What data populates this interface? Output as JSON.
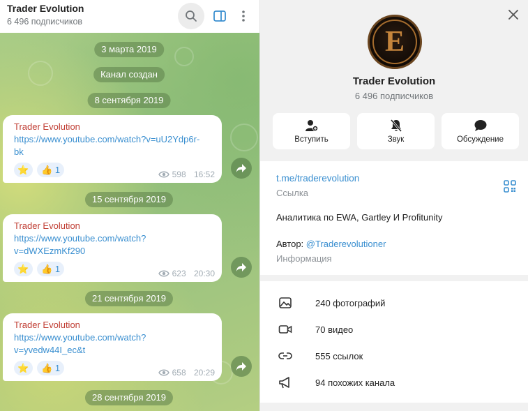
{
  "header": {
    "title": "Trader Evolution",
    "subtitle": "6 496 подписчиков",
    "icons": [
      "search-icon",
      "side-panel-icon",
      "more-vertical-icon"
    ]
  },
  "chat": {
    "date_pills": [
      "3 марта 2019",
      "Канал создан",
      "8 сентября 2019",
      "15 сентября 2019",
      "21 сентября 2019",
      "28 сентября 2019"
    ],
    "messages": [
      {
        "author": "Trader Evolution",
        "link": "https://www.youtube.com/watch?v=uU2Ydp6r-bk",
        "link_line1": "https://www.youtube.com/watch?v=uU2Ydp6r-",
        "link_line2": "bk",
        "reaction_star": "⭐",
        "reaction_like": "👍",
        "like_count": "1",
        "views": "598",
        "time": "16:52"
      },
      {
        "author": "Trader Evolution",
        "link": "https://www.youtube.com/watch?v=dWXEzmKf290",
        "link_line1": "https://www.youtube.com/watch?",
        "link_line2": "v=dWXEzmKf290",
        "reaction_star": "⭐",
        "reaction_like": "👍",
        "like_count": "1",
        "views": "623",
        "time": "20:30"
      },
      {
        "author": "Trader Evolution",
        "link": "https://www.youtube.com/watch?v=yvedw44I_ec&t",
        "link_line1": "https://www.youtube.com/watch?",
        "link_line2": "v=yvedw44I_ec&t",
        "reaction_star": "⭐",
        "reaction_like": "👍",
        "like_count": "1",
        "views": "658",
        "time": "20:29"
      }
    ]
  },
  "panel": {
    "avatar_letter": "E",
    "name": "Trader Evolution",
    "subscribers": "6 496 подписчиков",
    "actions": [
      {
        "label": "Вступить",
        "icon": "add-user-icon"
      },
      {
        "label": "Звук",
        "icon": "bell-muted-icon"
      },
      {
        "label": "Обсуждение",
        "icon": "chat-bubble-icon"
      }
    ],
    "info": {
      "link": "t.me/traderevolution",
      "link_caption": "Ссылка",
      "description": "Аналитика по EWA, Gartley И Profitunity",
      "author_prefix": "Автор:",
      "author_handle": "@Traderevolutioner",
      "author_caption": "Информация"
    },
    "media": [
      {
        "label": "240 фотографий",
        "icon": "photo-icon"
      },
      {
        "label": "70 видео",
        "icon": "video-icon"
      },
      {
        "label": "555 ссылок",
        "icon": "link-icon"
      },
      {
        "label": "94 похожих канала",
        "icon": "megaphone-icon"
      }
    ]
  },
  "colors": {
    "accent": "#3a8fd0",
    "author": "#c03d33",
    "chat_bg": "#9ec47f"
  }
}
